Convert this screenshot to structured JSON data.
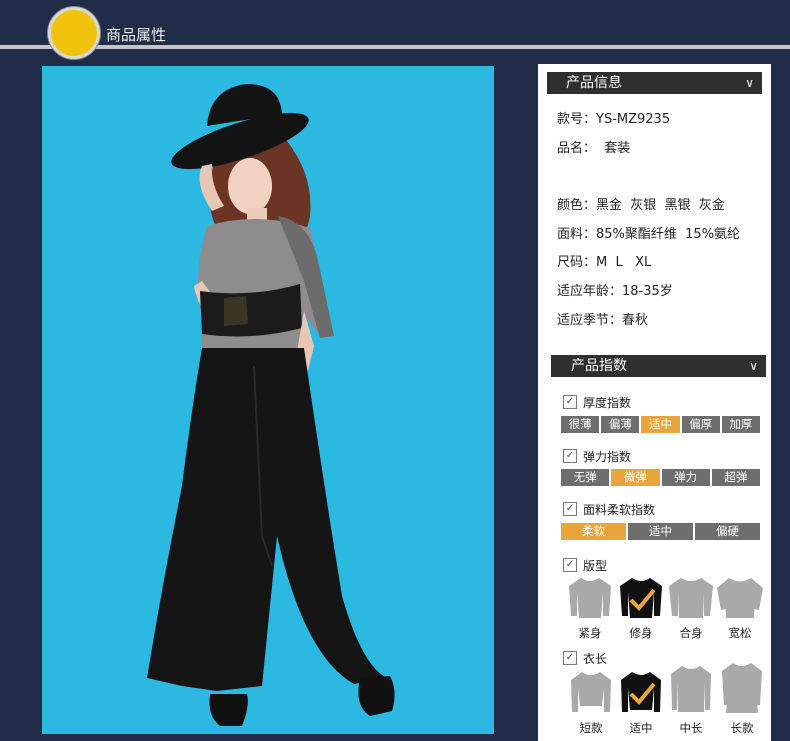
{
  "header": {
    "title": "商品属性"
  },
  "product_info": {
    "section_title": "产品信息",
    "style_no": "款号：YS-MZ9235",
    "name": "品名：  套装",
    "colors": "颜色：黑金  灰银  黑银  灰金",
    "fabric": "面料：85%聚酯纤维  15%氨纶",
    "sizes": "尺码：M  L   XL",
    "age": "适应年龄：18-35岁",
    "season": "适应季节：春秋"
  },
  "product_index": {
    "section_title": "产品指数",
    "thickness": {
      "label": "厚度指数",
      "options": [
        "很薄",
        "偏薄",
        "适中",
        "偏厚",
        "加厚"
      ],
      "selected": "适中"
    },
    "elasticity": {
      "label": "弹力指数",
      "options": [
        "无弹",
        "微弹",
        "弹力",
        "超弹"
      ],
      "selected": "微弹"
    },
    "softness": {
      "label": "面料柔软指数",
      "options": [
        "柔软",
        "适中",
        "偏硬"
      ],
      "selected": "柔软"
    },
    "fit": {
      "label": "版型",
      "options": [
        "紧身",
        "修身",
        "合身",
        "宽松"
      ],
      "selected": "修身"
    },
    "length": {
      "label": "衣长",
      "options": [
        "短款",
        "适中",
        "中长",
        "长款"
      ],
      "selected": "适中"
    }
  },
  "colors": {
    "background": "#212d48",
    "accent": "#e9a53b",
    "photo_bg": "#2bb9e1",
    "header_circle": "#f0c30d"
  }
}
